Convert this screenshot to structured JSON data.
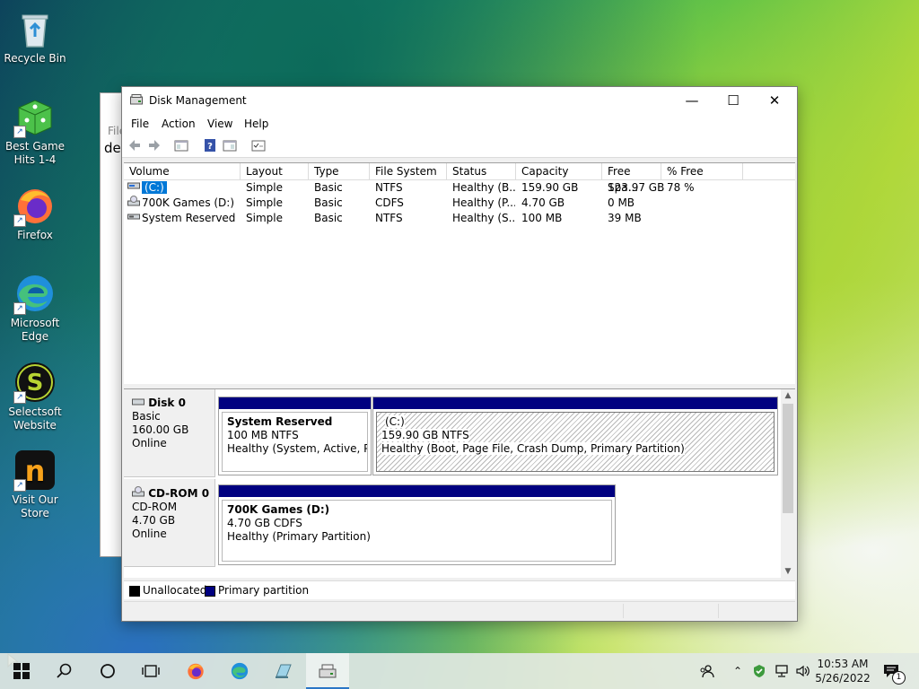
{
  "desktop": {
    "icons": [
      {
        "label": "Recycle Bin"
      },
      {
        "label": "Best Game Hits 1-4"
      },
      {
        "label": "Firefox"
      },
      {
        "label": "Microsoft Edge"
      },
      {
        "label": "Selectsoft Website"
      },
      {
        "label": "Visit Our Store"
      }
    ]
  },
  "background_window": {
    "text_top": "File",
    "text_mid": "de"
  },
  "window": {
    "title": "Disk Management",
    "menu": [
      "File",
      "Action",
      "View",
      "Help"
    ],
    "columns": [
      "Volume",
      "Layout",
      "Type",
      "File System",
      "Status",
      "Capacity",
      "Free Spa...",
      "% Free"
    ],
    "volumes": [
      {
        "volume": "(C:)",
        "layout": "Simple",
        "type": "Basic",
        "fs": "NTFS",
        "status": "Healthy (B...",
        "capacity": "159.90 GB",
        "free": "123.97 GB",
        "pct": "78 %"
      },
      {
        "volume": "700K Games (D:)",
        "layout": "Simple",
        "type": "Basic",
        "fs": "CDFS",
        "status": "Healthy (P...",
        "capacity": "4.70 GB",
        "free": "0 MB",
        "pct": ""
      },
      {
        "volume": "System Reserved",
        "layout": "Simple",
        "type": "Basic",
        "fs": "NTFS",
        "status": "Healthy (S...",
        "capacity": "100 MB",
        "free": "39 MB",
        "pct": ""
      }
    ],
    "disks": [
      {
        "name": "Disk 0",
        "kind": "Basic",
        "size": "160.00 GB",
        "state": "Online",
        "partitions": [
          {
            "name": "System Reserved",
            "fs": "100 MB NTFS",
            "status": "Healthy (System, Active, Prim"
          },
          {
            "name": "(C:)",
            "fs": "159.90 GB NTFS",
            "status": "Healthy (Boot, Page File, Crash Dump, Primary Partition)"
          }
        ]
      },
      {
        "name": "CD-ROM 0",
        "kind": "CD-ROM",
        "size": "4.70 GB",
        "state": "Online",
        "partitions": [
          {
            "name": "700K Games  (D:)",
            "fs": "4.70 GB CDFS",
            "status": "Healthy (Primary Partition)"
          }
        ]
      }
    ],
    "legend": [
      {
        "label": "Unallocated",
        "color": "#000000"
      },
      {
        "label": "Primary partition",
        "color": "#000080"
      }
    ]
  },
  "taskbar": {
    "clock_time": "10:53 AM",
    "clock_date": "5/26/2022",
    "notification_count": "1"
  }
}
